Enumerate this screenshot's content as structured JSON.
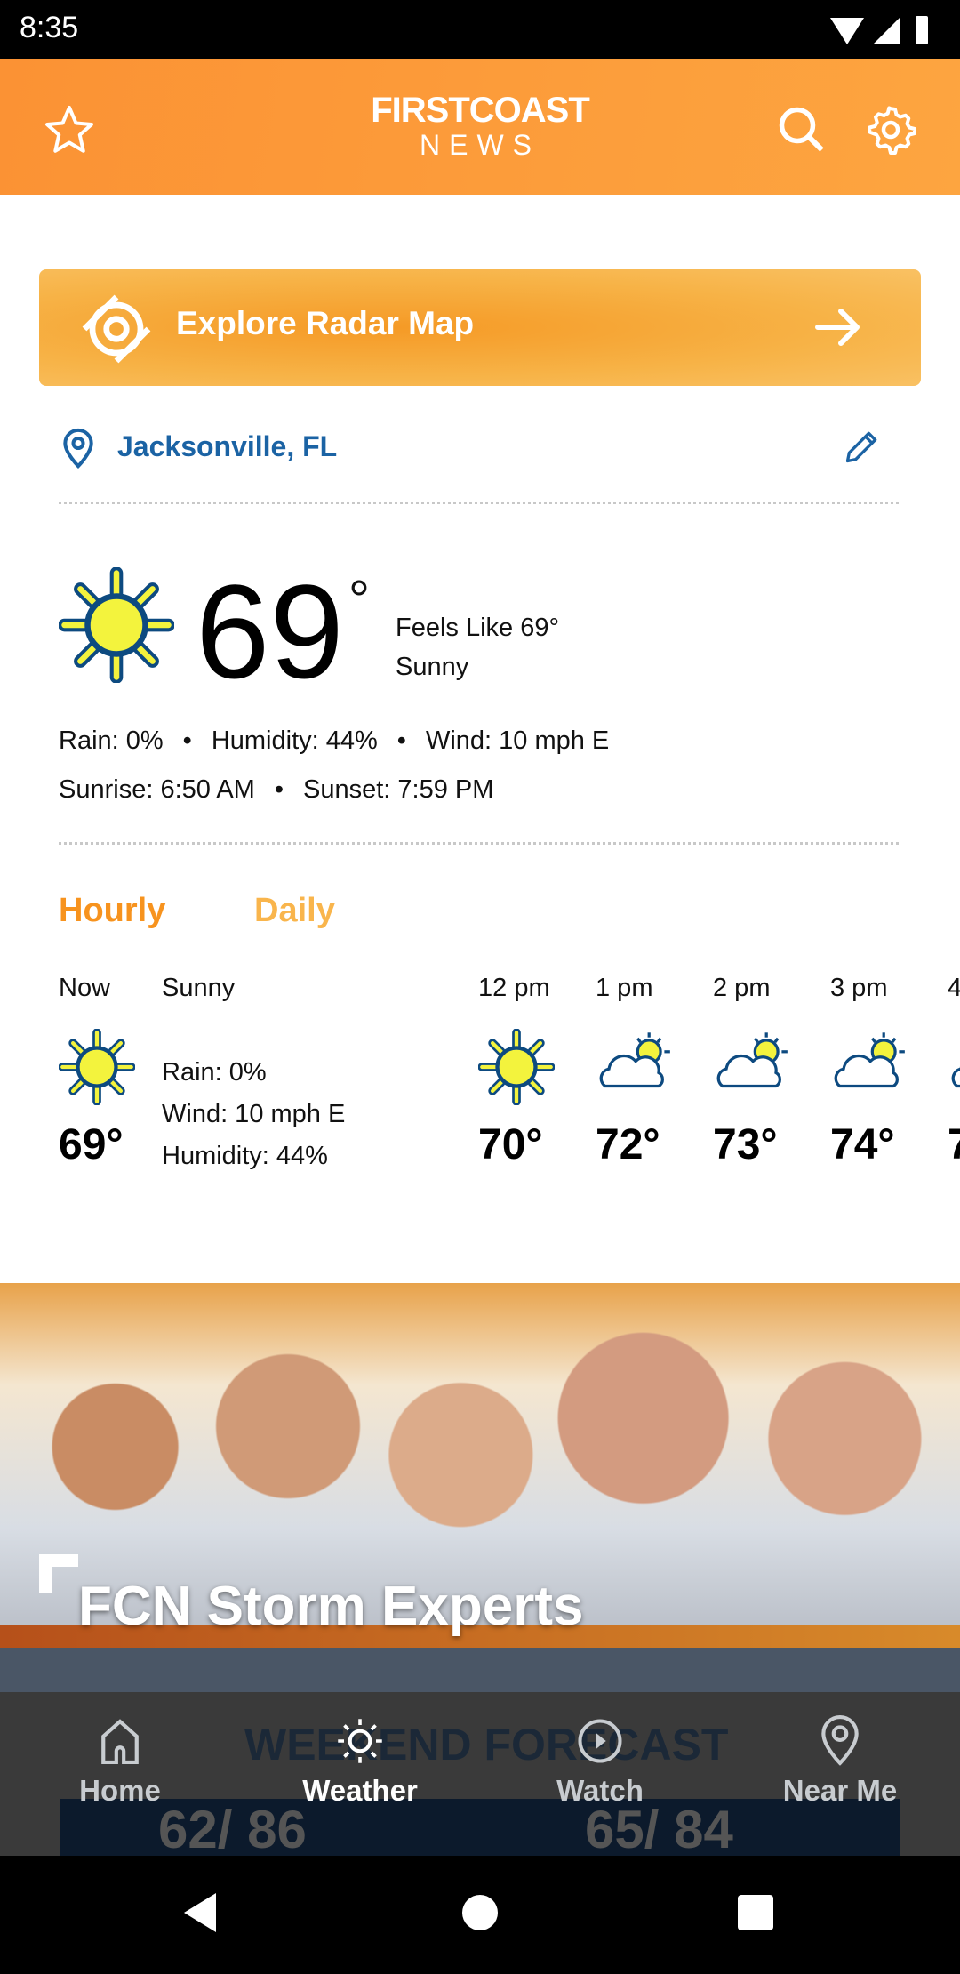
{
  "status_bar": {
    "time": "8:35"
  },
  "header": {
    "logo_line1": "FIRSTCOAST",
    "logo_line2": "NEWS",
    "icons": [
      "star-icon",
      "search-icon",
      "gear-icon"
    ]
  },
  "radar_banner": {
    "label": "Explore Radar Map"
  },
  "location": {
    "name": "Jacksonville, FL"
  },
  "current": {
    "temp": "69",
    "feels_like": "Feels Like 69°",
    "condition": "Sunny",
    "rain": "Rain: 0%",
    "humidity": "Humidity: 44%",
    "wind": "Wind: 10 mph E",
    "sunrise": "Sunrise: 6:50 AM",
    "sunset": "Sunset: 7:59 PM",
    "sep": "•"
  },
  "tabs": [
    {
      "label": "Hourly",
      "active": true
    },
    {
      "label": "Daily",
      "active": false
    }
  ],
  "hourly_now": {
    "label": "Now",
    "condition": "Sunny",
    "temp": "69°",
    "rain": "Rain: 0%",
    "wind": "Wind: 10 mph E",
    "humidity": "Humidity: 44%"
  },
  "hourly": [
    {
      "time": "12 pm",
      "temp": "70°",
      "icon": "sun-icon"
    },
    {
      "time": "1 pm",
      "temp": "72°",
      "icon": "partly-cloudy-icon"
    },
    {
      "time": "2 pm",
      "temp": "73°",
      "icon": "partly-cloudy-icon"
    },
    {
      "time": "3 pm",
      "temp": "74°",
      "icon": "partly-cloudy-icon"
    },
    {
      "time": "4",
      "temp": "7",
      "icon": "partly-cloudy-icon"
    }
  ],
  "promo": {
    "title": "FCN Storm Experts",
    "behind_text": "WEEKEND FORECAST",
    "behind_values": [
      "62/ 86",
      "65/ 84"
    ]
  },
  "bottom_nav": [
    {
      "label": "Home",
      "active": false
    },
    {
      "label": "Weather",
      "active": true
    },
    {
      "label": "Watch",
      "active": false
    },
    {
      "label": "Near Me",
      "active": false
    }
  ],
  "colors": {
    "accent": "#fb9234",
    "link": "#1b63a4",
    "tab_active": "#f7931e",
    "tab_inactive": "#f9b54c"
  }
}
